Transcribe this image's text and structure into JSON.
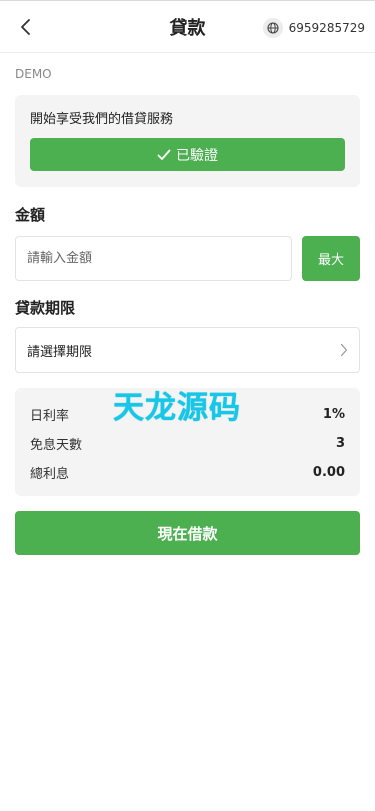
{
  "header": {
    "title": "貸款",
    "account": "6959285729"
  },
  "demo_label": "DEMO",
  "verify_card": {
    "hint": "開始享受我們的借貸服務",
    "button_label": "已驗證"
  },
  "amount": {
    "label": "金額",
    "placeholder": "請輸入金額",
    "max_label": "最大"
  },
  "period": {
    "label": "貸款期限",
    "select_text": "請選擇期限"
  },
  "summary": {
    "rows": [
      {
        "label": "日利率",
        "value": "1%"
      },
      {
        "label": "免息天數",
        "value": "3"
      },
      {
        "label": "總利息",
        "value": "0.00"
      }
    ],
    "watermark": "天龙源码"
  },
  "borrow_button": "現在借款",
  "colors": {
    "accent": "#4caf50",
    "watermark": "#15c7e8"
  },
  "icons": {
    "back": "chevron-left-icon",
    "globe": "globe-icon",
    "check": "check-icon",
    "select_arrow": "chevron-right-icon"
  }
}
